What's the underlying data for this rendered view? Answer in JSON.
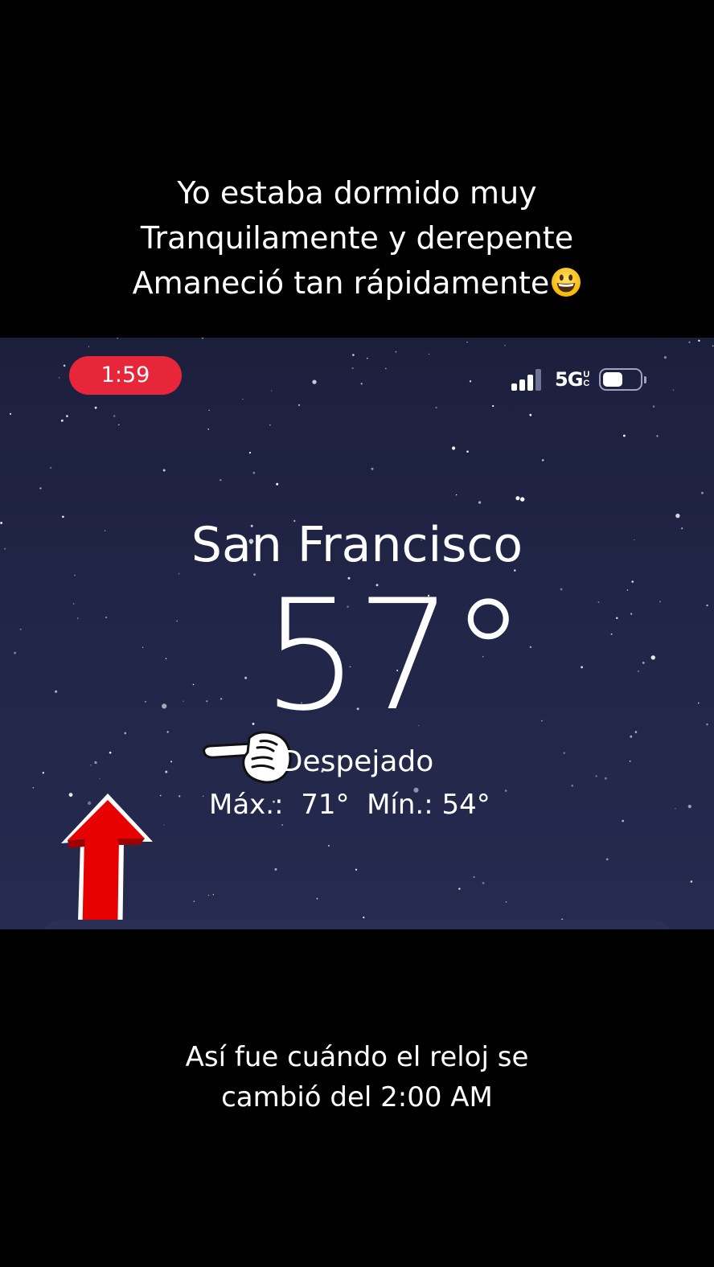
{
  "caption_top": {
    "lines": [
      "Yo estaba dormido muy",
      "Tranquilamente y derepente",
      "Amaneció tan rápidamente"
    ],
    "emoji": "grinning-face"
  },
  "status_bar": {
    "time": "1:59",
    "time_pill_color": "#e8263a",
    "network": "5G",
    "network_sub": "UC",
    "signal_bars": 4,
    "signal_bars_active": 3,
    "battery_level": 0.55
  },
  "weather": {
    "city": "San Francisco",
    "temperature": "57°",
    "condition": "Despejado",
    "high_label": "Máx.:",
    "high_value": "71°",
    "low_label": "Mín.:",
    "low_value": "54°",
    "background_color": "#212547"
  },
  "annotations": {
    "arrow_icon": "red-up-arrow-icon",
    "arrow_color": "#e60000",
    "hand_icon": "pointing-hand-icon"
  },
  "caption_bottom": {
    "lines": [
      "Así fue cuándo el reloj se",
      "cambió del 2:00 AM"
    ]
  }
}
